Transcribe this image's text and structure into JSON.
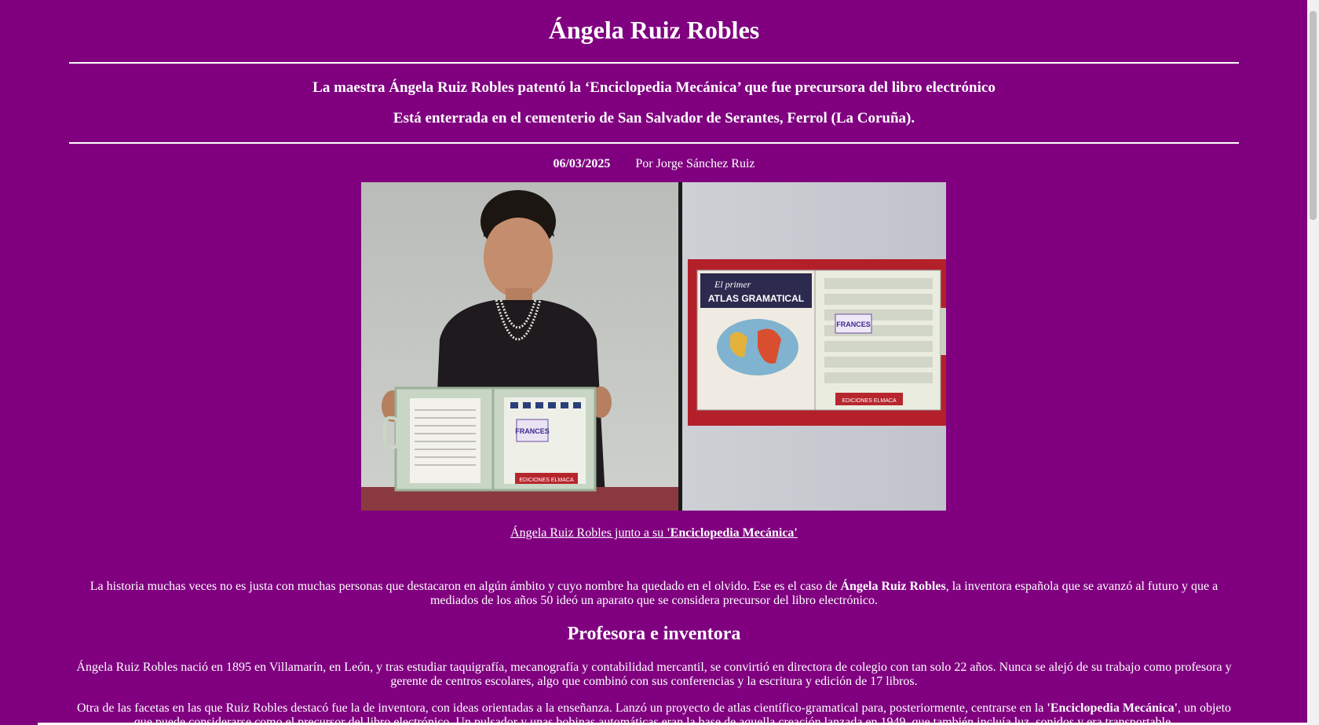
{
  "article": {
    "title": "Ángela Ruiz Robles",
    "subtitle1": "La maestra Ángela Ruiz Robles patentó la ‘Enciclopedia Mecánica’ que fue precursora del libro electrónico",
    "subtitle2": "Está enterrada en el cementerio de San Salvador de Serantes, Ferrol (La Coruña).",
    "date": "06/03/2025",
    "author": "Por Jorge Sánchez Ruiz",
    "caption_prefix": "Ángela Ruiz Robles junto a su ",
    "caption_bold": "'Enciclopedia Mecánica'",
    "p1_a": "La historia muchas veces no es justa con muchas personas que destacaron en algún ámbito y cuyo nombre ha quedado en el olvido. Ese es el caso de ",
    "p1_bold": "Ángela Ruiz Robles",
    "p1_b": ", la inventora española que se avanzó al futuro y que a mediados de los años 50 ideó un aparato que se considera precursor del libro electrónico.",
    "section_heading": "Profesora e inventora",
    "p2": "Ángela Ruiz Robles nació en 1895 en Villamarín, en León, y tras estudiar taquigrafía, mecanografía y contabilidad mercantil, se convirtió en directora de colegio con tan solo 22 años. Nunca se alejó de su trabajo como profesora y gerente de centros escolares, algo que combinó con sus conferencias y la escritura y edición de 17 libros.",
    "p3_a": "Otra de las facetas en las que Ruiz Robles destacó fue la de inventora, con ideas orientadas a la enseñanza. Lanzó un proyecto de atlas científico-gramatical para, posteriormente, centrarse en la ",
    "p3_bold": "'Enciclopedia Mecánica'",
    "p3_b": ", un objeto que puede considerarse como el precursor del libro electrónico. Un pulsador y unas bobinas automáticas eran la base de aquella creación lanzada en 1949, que también incluía luz, sonidos y era transportable."
  },
  "photo": {
    "left_label": "FRANCES",
    "left_case_label": "EDICIONES ELMACA",
    "right_cover_script": "El primer",
    "right_cover_title": "ATLAS GRAMATICAL",
    "right_label": "FRANCES",
    "right_case_label": "EDICIONES ELMACA"
  },
  "colors": {
    "background": "#800080",
    "text": "#ffffff"
  }
}
